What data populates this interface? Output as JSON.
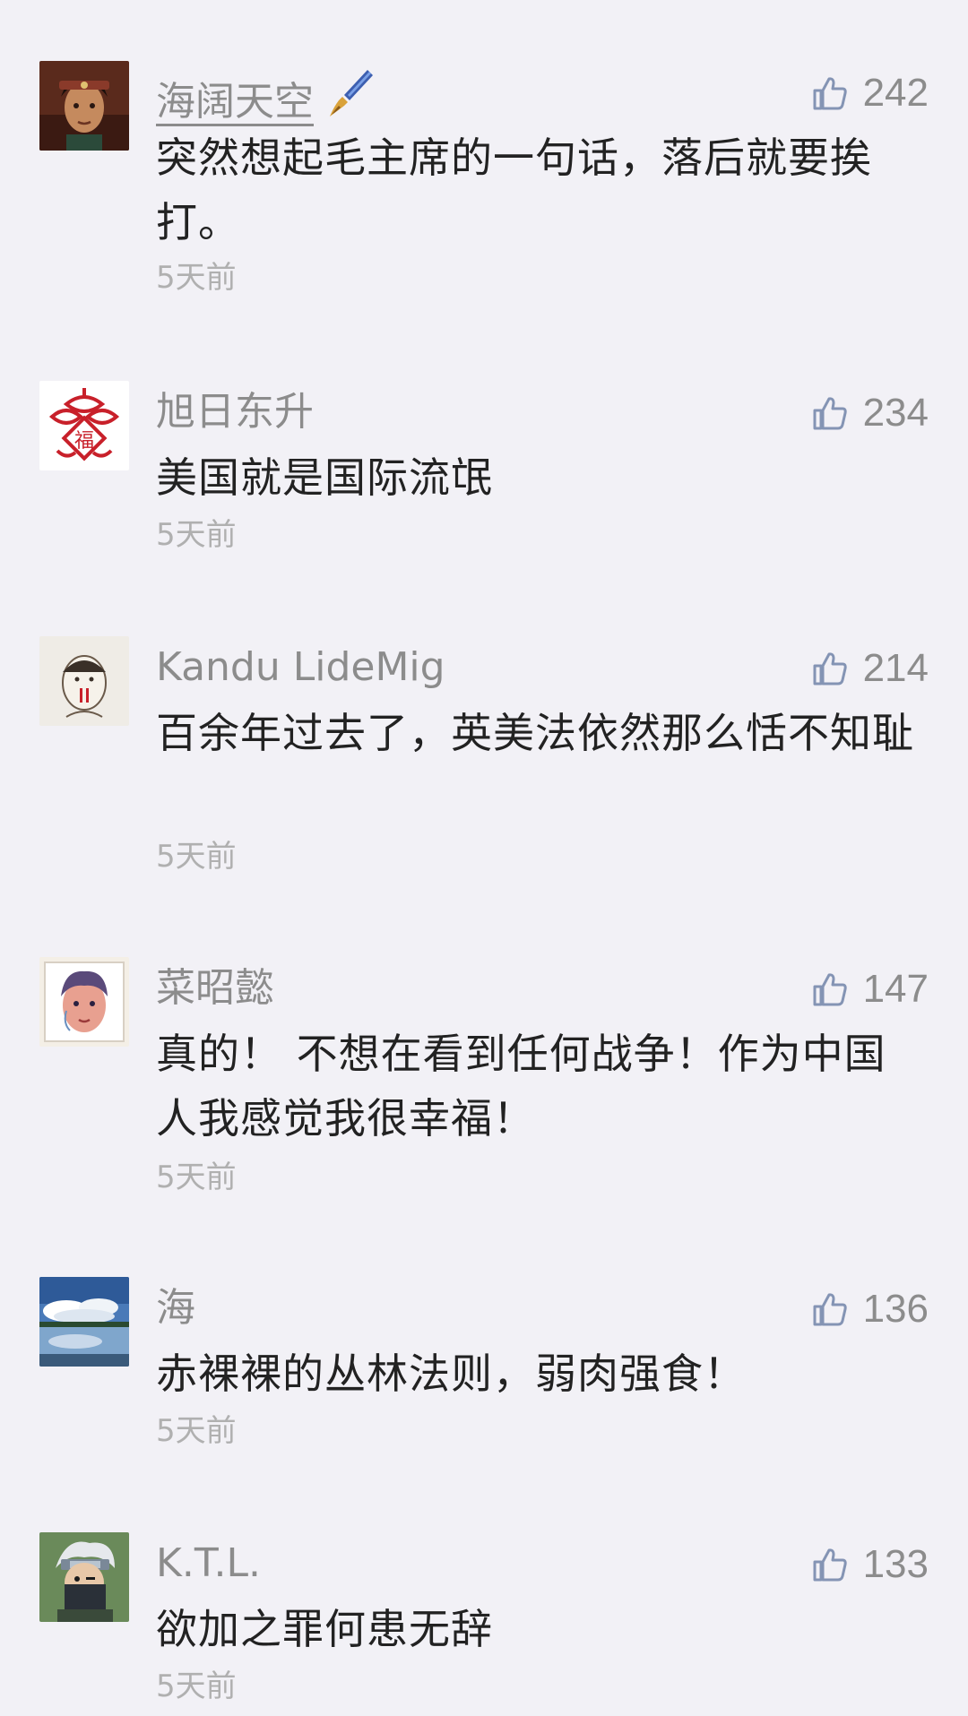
{
  "comments": [
    {
      "name": "海阔天空",
      "likes": "242",
      "text": "突然想起毛主席的一句话，落后就要挨打。",
      "time": "5天前",
      "avatar_icon": "person-portrait-avatar",
      "name_badge_icon": "paintbrush-icon"
    },
    {
      "name": "旭日东升",
      "likes": "234",
      "text": "美国就是国际流氓",
      "time": "5天前",
      "avatar_icon": "chinese-knot-fu-avatar"
    },
    {
      "name": "Kandu LideMig",
      "likes": "214",
      "text": "百余年过去了，英美法依然那么恬不知耻",
      "time": "5天前",
      "avatar_icon": "cartoon-sketch-avatar"
    },
    {
      "name": "菜昭懿",
      "likes": "147",
      "text": "真的！ 不想在看到任何战争！作为中国人我感觉我很幸福！",
      "time": "5天前",
      "avatar_icon": "watercolor-face-avatar"
    },
    {
      "name": "海",
      "likes": "136",
      "text": "赤裸裸的丛林法则，弱肉强食！",
      "time": "5天前",
      "avatar_icon": "landscape-lake-avatar"
    },
    {
      "name": "K.T.L.",
      "likes": "133",
      "text": "欲加之罪何患无辞",
      "time": "5天前",
      "avatar_icon": "masked-ninja-avatar"
    }
  ],
  "colors": {
    "background": "#f2f1f6",
    "name": "#8c8c8c",
    "text": "#222222",
    "time": "#b0b0b0",
    "like_icon": "#8494b4"
  }
}
